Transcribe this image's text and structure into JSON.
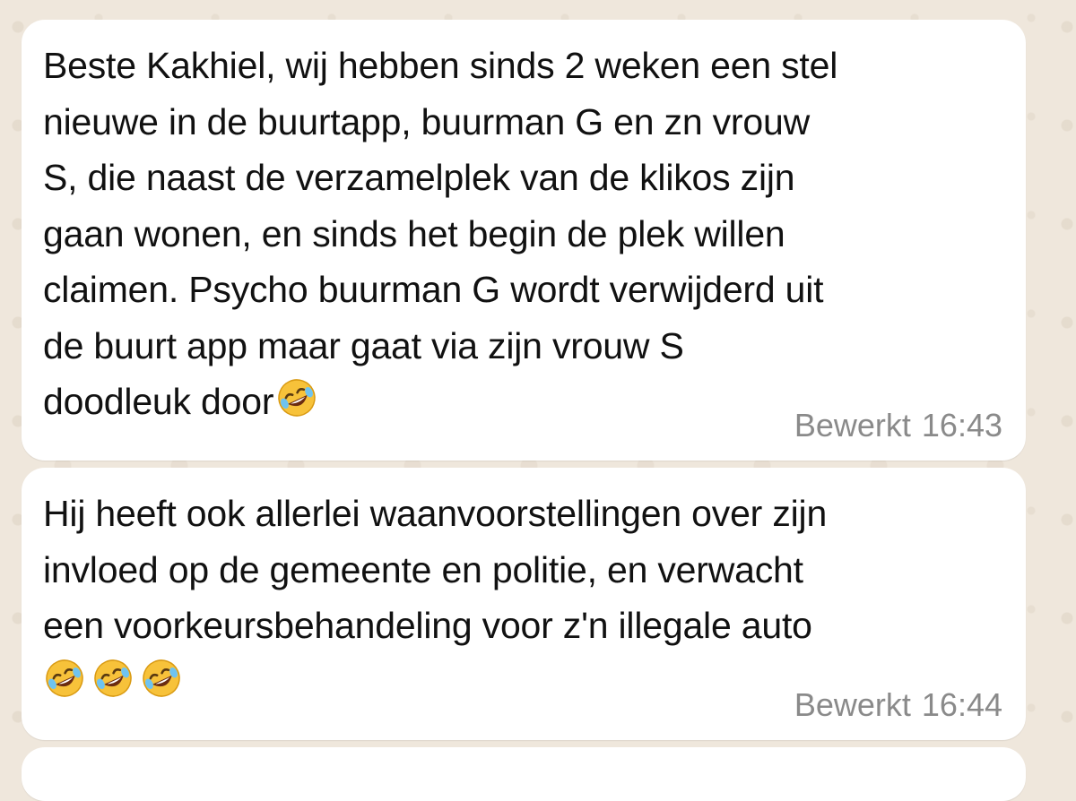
{
  "messages": [
    {
      "lines": [
        "Beste Kakhiel, wij hebben sinds 2 weken een stel",
        "nieuwe in de buurtapp, buurman G en zn vrouw",
        "S, die naast de verzamelplek van de klikos zijn",
        "gaan wonen, en sinds het begin de plek willen",
        "claimen. Psycho buurman G wordt verwijderd uit",
        "de buurt app maar gaat via zijn vrouw S",
        "doodleuk door"
      ],
      "trailing_emoji": "rolling-on-floor-laughing",
      "edited_label": "Bewerkt",
      "time": "16:43"
    },
    {
      "lines": [
        "Hij heeft ook allerlei waanvoorstellingen over zijn",
        "invloed op de gemeente en politie, en verwacht",
        "een voorkeursbehandeling voor z'n illegale auto"
      ],
      "emoji_line": [
        "rolling-on-floor-laughing",
        "rolling-on-floor-laughing",
        "rolling-on-floor-laughing"
      ],
      "edited_label": "Bewerkt",
      "time": "16:44"
    }
  ],
  "colors": {
    "bubble": "#ffffff",
    "background": "#efe7dc",
    "text": "#111111",
    "meta": "#8a8a8a",
    "emoji_face": "#f7c23a"
  }
}
